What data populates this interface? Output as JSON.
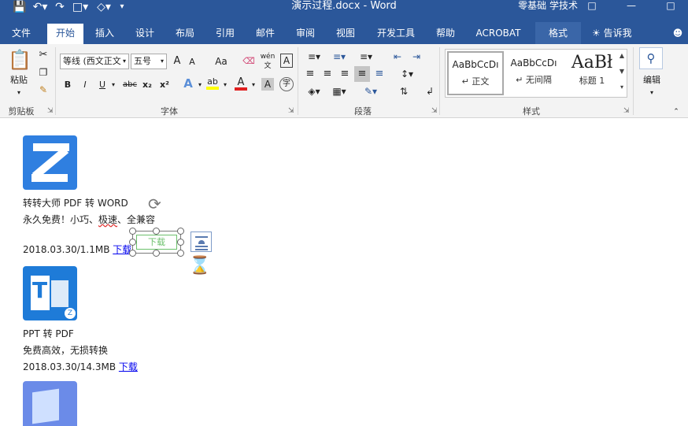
{
  "window": {
    "title": "演示过程.docx  -  Word",
    "user": "零基础 学技术",
    "minimize": "—",
    "restore": "□"
  },
  "tabs": [
    "文件",
    "开始",
    "插入",
    "设计",
    "布局",
    "引用",
    "邮件",
    "审阅",
    "视图",
    "开发工具",
    "帮助",
    "ACROBAT",
    "格式"
  ],
  "tell_me": "告诉我",
  "ribbon": {
    "clipboard": {
      "paste": "粘贴",
      "label": "剪贴板"
    },
    "font": {
      "font_name": "等线 (西文正文",
      "font_size": "五号",
      "bold": "B",
      "italic": "I",
      "underline": "U",
      "strike": "abc",
      "sub": "x₂",
      "sup": "x²",
      "grow": "A",
      "shrink": "A",
      "case": "Aa",
      "phonetic": "wén文",
      "border_char": "A",
      "effects": "A",
      "highlight": "ab",
      "color": "A",
      "shading": "A",
      "enclose": "字",
      "label": "字体"
    },
    "paragraph": {
      "label": "段落"
    },
    "styles": {
      "items": [
        {
          "sample": "AaBbCcDı",
          "name": "↵ 正文"
        },
        {
          "sample": "AaBbCcDı",
          "name": "↵ 无间隔"
        },
        {
          "sample": "AaBł",
          "name": "标题 1"
        }
      ],
      "label": "样式"
    },
    "editing": {
      "label": "编辑"
    }
  },
  "document": {
    "items": [
      {
        "title": "转转大师 PDF 转 WORD",
        "desc_prefix": "永久免费！小巧、",
        "desc_squiggle": "极速",
        "desc_suffix": "、全兼容",
        "meta": "2018.03.30/1.1MB ",
        "link": "下载"
      },
      {
        "title": "PPT 转 PDF",
        "desc": "免费高效，无损转换",
        "meta": "2018.03.30/14.3MB ",
        "link": "下载"
      }
    ],
    "textbox": "下载",
    "icon2_letter": "T",
    "icon2_badge": "Z"
  }
}
